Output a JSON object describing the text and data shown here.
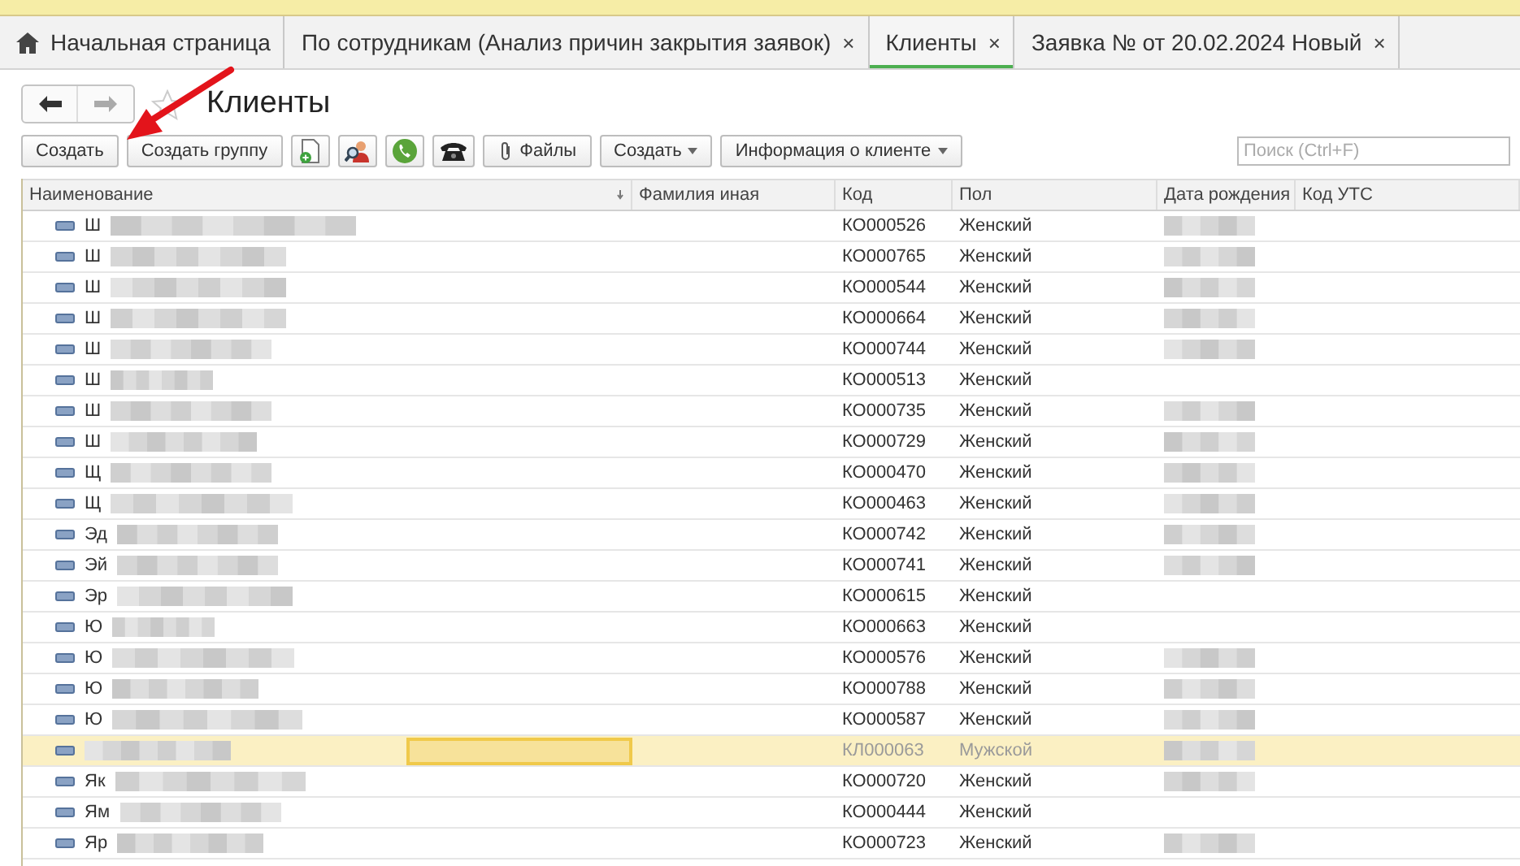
{
  "tabs": [
    {
      "label": "Начальная страница",
      "kind": "home",
      "selected": false
    },
    {
      "label": "По сотрудникам (Анализ причин закрытия заявок)",
      "kind": "page",
      "selected": false
    },
    {
      "label": "Клиенты",
      "kind": "page",
      "selected": true
    },
    {
      "label": "Заявка №  от 20.02.2024 Новый",
      "kind": "page",
      "selected": false
    }
  ],
  "close_glyph": "×",
  "form": {
    "title": "Клиенты",
    "favorite": false
  },
  "toolbar": [
    {
      "kind": "button",
      "label": "Создать"
    },
    {
      "kind": "button",
      "label": "Создать группу"
    },
    {
      "kind": "icon"
    },
    {
      "kind": "icon"
    },
    {
      "kind": "icon"
    },
    {
      "kind": "icon"
    },
    {
      "kind": "attach",
      "label": "Файлы"
    },
    {
      "kind": "menu",
      "label": "Создать"
    },
    {
      "kind": "menu",
      "label": "Информация о клиенте"
    }
  ],
  "search": {
    "placeholder": "Поиск (Ctrl+F)"
  },
  "table": {
    "columns": [
      "Наименование",
      "Фамилия иная",
      "Код",
      "Пол",
      "Дата рождения",
      "Код УТС"
    ],
    "rows": [
      {
        "name": "Ш",
        "code": "КО000526",
        "sex": "Женский",
        "selected": false,
        "dimmed": false
      },
      {
        "name": "Ш",
        "code": "КО000765",
        "sex": "Женский",
        "selected": false,
        "dimmed": false
      },
      {
        "name": "Ш",
        "code": "КО000544",
        "sex": "Женский",
        "selected": false,
        "dimmed": false
      },
      {
        "name": "Ш",
        "code": "КО000664",
        "sex": "Женский",
        "selected": false,
        "dimmed": false
      },
      {
        "name": "Ш",
        "code": "КО000744",
        "sex": "Женский",
        "selected": false,
        "dimmed": false
      },
      {
        "name": "Ш",
        "code": "КО000513",
        "sex": "Женский",
        "selected": false,
        "dimmed": false
      },
      {
        "name": "Ш",
        "code": "КО000735",
        "sex": "Женский",
        "selected": false,
        "dimmed": false
      },
      {
        "name": "Ш",
        "code": "КО000729",
        "sex": "Женский",
        "selected": false,
        "dimmed": false
      },
      {
        "name": "Щ",
        "code": "КО000470",
        "sex": "Женский",
        "selected": false,
        "dimmed": false
      },
      {
        "name": "Щ",
        "code": "КО000463",
        "sex": "Женский",
        "selected": false,
        "dimmed": false
      },
      {
        "name": "Эд",
        "code": "КО000742",
        "sex": "Женский",
        "selected": false,
        "dimmed": false
      },
      {
        "name": "Эй",
        "code": "КО000741",
        "sex": "Женский",
        "selected": false,
        "dimmed": false
      },
      {
        "name": "Эр",
        "code": "КО000615",
        "sex": "Женский",
        "selected": false,
        "dimmed": false
      },
      {
        "name": "Ю",
        "code": "КО000663",
        "sex": "Женский",
        "selected": false,
        "dimmed": false
      },
      {
        "name": "Ю",
        "code": "КО000576",
        "sex": "Женский",
        "selected": false,
        "dimmed": false
      },
      {
        "name": "Ю",
        "code": "КО000788",
        "sex": "Женский",
        "selected": false,
        "dimmed": false
      },
      {
        "name": "Ю",
        "code": "КО000587",
        "sex": "Женский",
        "selected": false,
        "dimmed": false
      },
      {
        "name": "",
        "code": "КЛ000063",
        "sex": "Мужской",
        "selected": true,
        "dimmed": true
      },
      {
        "name": "Як",
        "code": "КО000720",
        "sex": "Женский",
        "selected": false,
        "dimmed": false
      },
      {
        "name": "Ям",
        "code": "КО000444",
        "sex": "Женский",
        "selected": false,
        "dimmed": false
      },
      {
        "name": "Яр",
        "code": "КО000723",
        "sex": "Женский",
        "selected": false,
        "dimmed": false
      }
    ]
  }
}
